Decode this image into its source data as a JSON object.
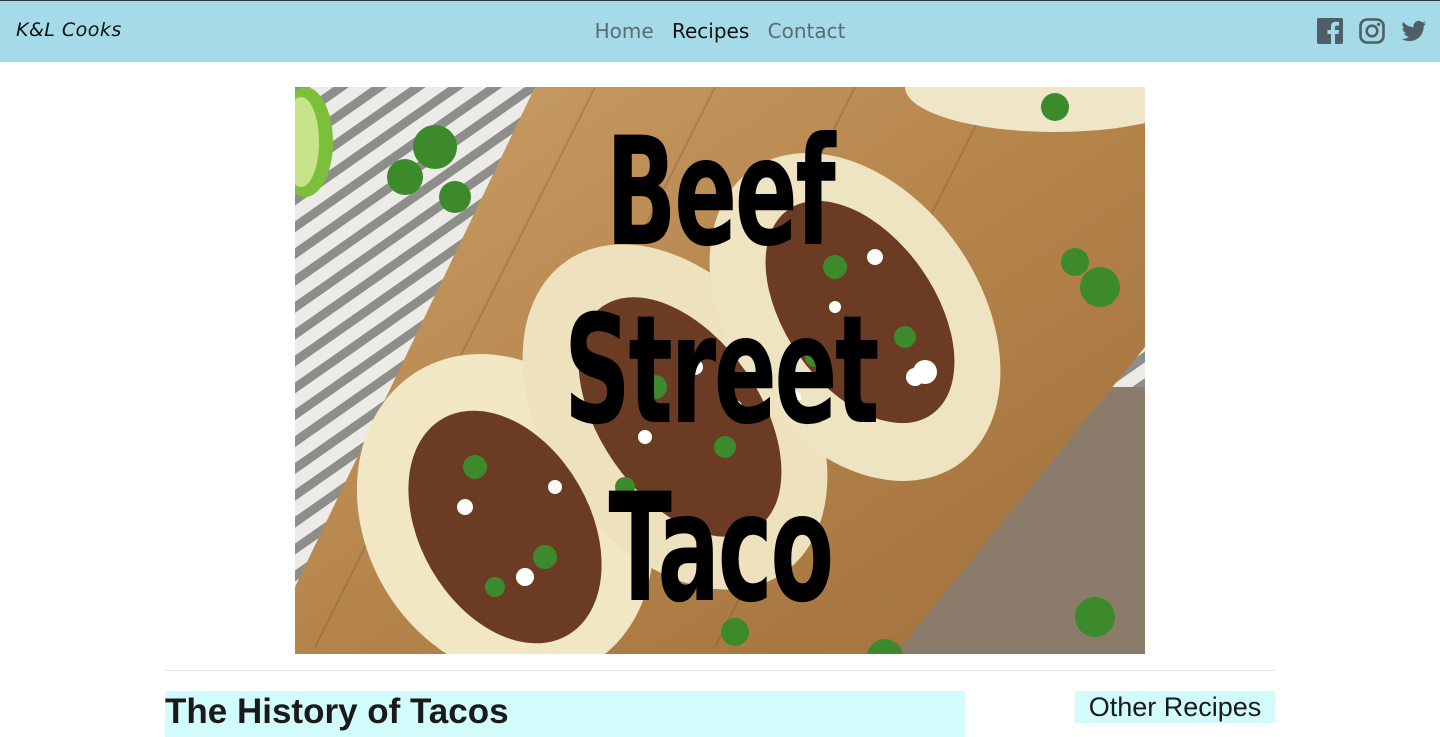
{
  "navbar": {
    "brand": "K&L Cooks",
    "links": [
      "Home",
      "Recipes",
      "Contact"
    ],
    "active": "Recipes",
    "social_icons": [
      "facebook-icon",
      "instagram-icon",
      "twitter-icon"
    ],
    "background": "#a5dbe8"
  },
  "hero": {
    "title_lines": [
      "Beef",
      "Street",
      "Taco"
    ],
    "image": "beef street tacos on wooden cutting board"
  },
  "main": {
    "heading": "The History of Tacos"
  },
  "sidebar": {
    "heading": "Other Recipes"
  },
  "colors": {
    "heading_highlight": "#d2fbfb",
    "nav_text": "#5a6b73",
    "nav_active": "#111111"
  }
}
